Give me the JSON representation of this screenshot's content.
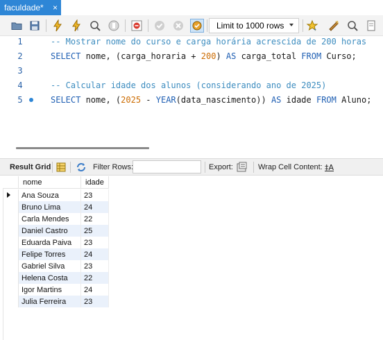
{
  "tab": {
    "title": "faculdade*",
    "close": "×"
  },
  "toolbar": {
    "limit_value": "Limit to 1000 rows"
  },
  "editor": {
    "lines": [
      {
        "num": "1",
        "text": "-- Mostrar nome do curso e carga horária acrescida de 200 horas"
      },
      {
        "num": "2",
        "parts": [
          "SELECT",
          " nome, (carga_horaria + ",
          "200",
          ") ",
          "AS",
          " carga_total ",
          "FROM",
          " Curso;"
        ]
      },
      {
        "num": "3",
        "text": ""
      },
      {
        "num": "4",
        "text": "-- Calcular idade dos alunos (considerando ano de 2025)"
      },
      {
        "num": "5",
        "parts": [
          "SELECT",
          " nome, (",
          "2025",
          " - ",
          "YEAR",
          "(data_nascimento)) ",
          "AS",
          " idade ",
          "FROM",
          " Aluno;"
        ]
      }
    ]
  },
  "result_toolbar": {
    "result_grid": "Result Grid",
    "filter_rows": "Filter Rows:",
    "filter_value": "",
    "export": "Export:",
    "wrap": "Wrap Cell Content:",
    "wrap_icon": "‡A"
  },
  "grid": {
    "columns": [
      "nome",
      "idade"
    ],
    "rows": [
      [
        "Ana Souza",
        "23"
      ],
      [
        "Bruno Lima",
        "24"
      ],
      [
        "Carla Mendes",
        "22"
      ],
      [
        "Daniel Castro",
        "25"
      ],
      [
        "Eduarda Paiva",
        "23"
      ],
      [
        "Felipe Torres",
        "24"
      ],
      [
        "Gabriel Silva",
        "23"
      ],
      [
        "Helena Costa",
        "22"
      ],
      [
        "Igor Martins",
        "24"
      ],
      [
        "Julia Ferreira",
        "23"
      ]
    ]
  }
}
